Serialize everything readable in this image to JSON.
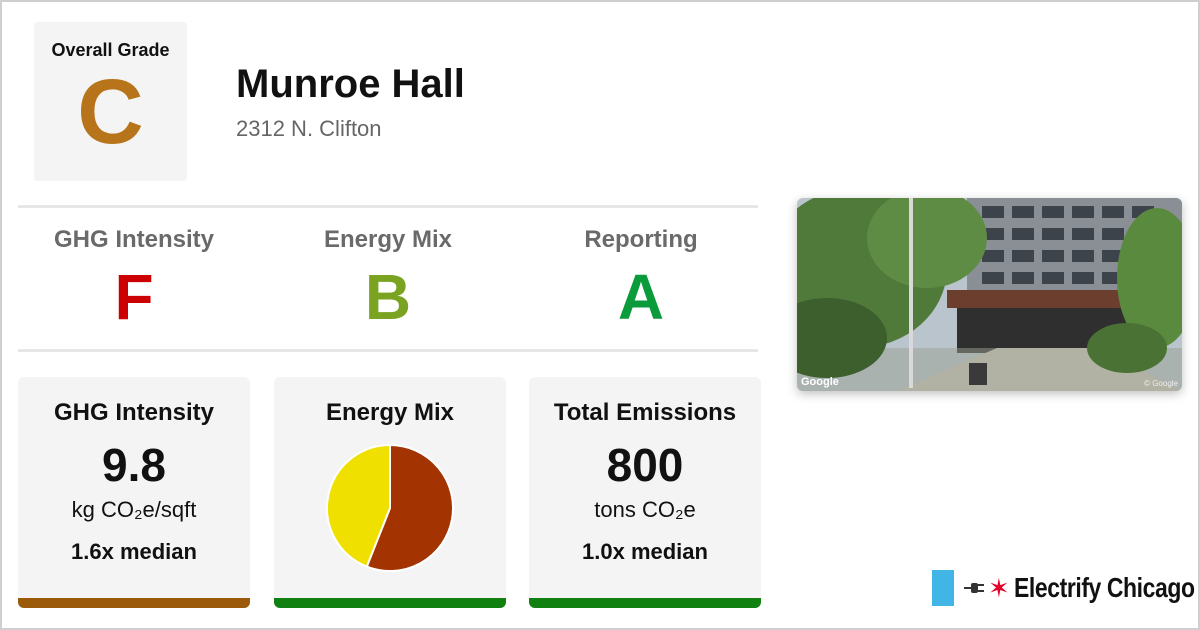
{
  "overall": {
    "label": "Overall Grade",
    "grade": "C",
    "color": "#b8741a"
  },
  "building": {
    "name": "Munroe Hall",
    "address": "2312 N. Clifton"
  },
  "grades": [
    {
      "label": "GHG Intensity",
      "grade": "F",
      "color": "#cc0000"
    },
    {
      "label": "Energy Mix",
      "grade": "B",
      "color": "#7aa321"
    },
    {
      "label": "Reporting",
      "grade": "A",
      "color": "#0a9b3a"
    }
  ],
  "cards": {
    "ghg": {
      "title": "GHG Intensity",
      "value": "9.8",
      "unit": "kg CO₂e/sqft",
      "median": "1.6x median",
      "bar_color": "#9b5a0a"
    },
    "mix": {
      "title": "Energy Mix",
      "bar_color": "#108010"
    },
    "emissions": {
      "title": "Total Emissions",
      "value": "800",
      "unit": "tons CO₂e",
      "median": "1.0x median",
      "bar_color": "#108010"
    }
  },
  "chart_data": {
    "type": "pie",
    "title": "Energy Mix",
    "slices": [
      {
        "value": 56,
        "color": "#a33300"
      },
      {
        "value": 44,
        "color": "#f0e000"
      }
    ]
  },
  "photo": {
    "attribution": "Google",
    "copyright": "© Google"
  },
  "brand": {
    "name": "Electrify Chicago",
    "star": "✶",
    "flag_color": "#41b6e6"
  }
}
